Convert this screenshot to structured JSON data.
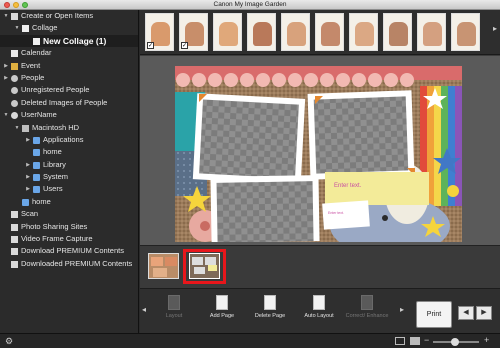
{
  "window": {
    "title": "Canon My Image Garden"
  },
  "sidebar": {
    "items": [
      {
        "label": "Create or Open Items",
        "level": 0,
        "expander": "open",
        "icon": "create-items-icon"
      },
      {
        "label": "Collage",
        "level": 1,
        "expander": "open",
        "icon": "collage-icon"
      },
      {
        "label": "New Collage (1)",
        "level": 2,
        "expander": "",
        "icon": "collage-doc-icon",
        "selected": true
      },
      {
        "label": "Calendar",
        "level": 0,
        "expander": "",
        "icon": "calendar-icon"
      },
      {
        "label": "Event",
        "level": 0,
        "expander": "closed",
        "icon": "event-icon"
      },
      {
        "label": "People",
        "level": 0,
        "expander": "closed",
        "icon": "people-icon"
      },
      {
        "label": "Unregistered People",
        "level": 0,
        "expander": "",
        "icon": "unregistered-people-icon"
      },
      {
        "label": "Deleted Images of People",
        "level": 0,
        "expander": "",
        "icon": "deleted-people-icon"
      },
      {
        "label": "UserName",
        "level": 0,
        "expander": "open",
        "icon": "user-icon"
      },
      {
        "label": "Macintosh HD",
        "level": 1,
        "expander": "open",
        "icon": "hard-drive-icon"
      },
      {
        "label": "Applications",
        "level": 2,
        "expander": "closed",
        "icon": "folder-icon"
      },
      {
        "label": "home",
        "level": 2,
        "expander": "",
        "icon": "folder-icon"
      },
      {
        "label": "Library",
        "level": 2,
        "expander": "closed",
        "icon": "folder-icon"
      },
      {
        "label": "System",
        "level": 2,
        "expander": "closed",
        "icon": "folder-icon"
      },
      {
        "label": "Users",
        "level": 2,
        "expander": "closed",
        "icon": "folder-icon"
      },
      {
        "label": "home",
        "level": 1,
        "expander": "",
        "icon": "folder-icon"
      },
      {
        "label": "Scan",
        "level": 0,
        "expander": "",
        "icon": "scan-icon"
      },
      {
        "label": "Photo Sharing Sites",
        "level": 0,
        "expander": "",
        "icon": "sharing-sites-icon"
      },
      {
        "label": "Video Frame Capture",
        "level": 0,
        "expander": "",
        "icon": "video-capture-icon"
      },
      {
        "label": "Download PREMIUM Contents",
        "level": 0,
        "expander": "",
        "icon": "download-icon"
      },
      {
        "label": "Downloaded PREMIUM Contents",
        "level": 0,
        "expander": "",
        "icon": "downloaded-icon"
      }
    ]
  },
  "filmstrip": {
    "thumbnails": [
      {
        "checked": true,
        "color": "#d99a6c"
      },
      {
        "checked": true,
        "color": "#c88e6a"
      },
      {
        "checked": false,
        "color": "#e0a87a"
      },
      {
        "checked": false,
        "color": "#b9795a"
      },
      {
        "checked": false,
        "color": "#d8a27c"
      },
      {
        "checked": false,
        "color": "#c4896b"
      },
      {
        "checked": false,
        "color": "#dba884"
      },
      {
        "checked": false,
        "color": "#b88466"
      },
      {
        "checked": false,
        "color": "#d4a080"
      },
      {
        "checked": false,
        "color": "#c89473"
      }
    ],
    "check_glyph": "✓"
  },
  "canvas": {
    "text_placeholder": "Enter text.",
    "small_text": "Enter text.",
    "colors": {
      "bunting": "#d96b6b",
      "fabric": "#b4865a",
      "stripes": [
        "#e14b3b",
        "#f0a13a",
        "#f4d64a",
        "#5db35a",
        "#3f7fd1",
        "#8a55b8"
      ]
    }
  },
  "pages": {
    "count": 2,
    "selected_index": 1
  },
  "toolbar": {
    "buttons": [
      {
        "label": "Layout",
        "disabled": true
      },
      {
        "label": "Add Page",
        "disabled": false
      },
      {
        "label": "Delete Page",
        "disabled": false
      },
      {
        "label": "Auto Layout",
        "disabled": false
      },
      {
        "label": "Correct/ Enhance",
        "disabled": true
      }
    ],
    "print_label": "Print",
    "prev_glyph": "◀",
    "next_glyph": "▶",
    "left_arrow": "◂",
    "right_arrow": "▸"
  },
  "highlight_color": "#e8161b",
  "zoom": {
    "minus": "−",
    "plus": "+"
  }
}
